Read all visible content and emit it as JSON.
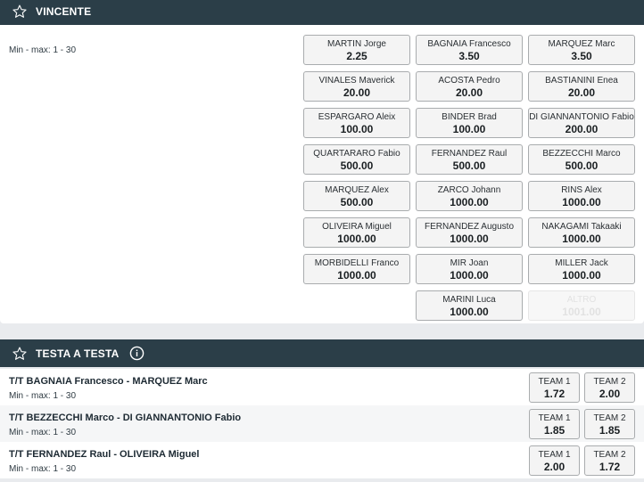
{
  "vincente": {
    "title": "VINCENTE",
    "minmax": "Min - max: 1 - 30",
    "odds": [
      {
        "label": "MARTIN Jorge",
        "value": "2.25"
      },
      {
        "label": "BAGNAIA Francesco",
        "value": "3.50"
      },
      {
        "label": "MARQUEZ Marc",
        "value": "3.50"
      },
      {
        "label": "VINALES Maverick",
        "value": "20.00"
      },
      {
        "label": "ACOSTA Pedro",
        "value": "20.00"
      },
      {
        "label": "BASTIANINI Enea",
        "value": "20.00"
      },
      {
        "label": "ESPARGARO Aleix",
        "value": "100.00"
      },
      {
        "label": "BINDER Brad",
        "value": "100.00"
      },
      {
        "label": "DI GIANNANTONIO Fabio",
        "value": "200.00"
      },
      {
        "label": "QUARTARARO Fabio",
        "value": "500.00"
      },
      {
        "label": "FERNANDEZ Raul",
        "value": "500.00"
      },
      {
        "label": "BEZZECCHI Marco",
        "value": "500.00"
      },
      {
        "label": "MARQUEZ Alex",
        "value": "500.00"
      },
      {
        "label": "ZARCO Johann",
        "value": "1000.00"
      },
      {
        "label": "RINS Alex",
        "value": "1000.00"
      },
      {
        "label": "OLIVEIRA Miguel",
        "value": "1000.00"
      },
      {
        "label": "FERNANDEZ Augusto",
        "value": "1000.00"
      },
      {
        "label": "NAKAGAMI Takaaki",
        "value": "1000.00"
      },
      {
        "label": "MORBIDELLI Franco",
        "value": "1000.00"
      },
      {
        "label": "MIR Joan",
        "value": "1000.00"
      },
      {
        "label": "MILLER Jack",
        "value": "1000.00"
      },
      {
        "label": "MARINI Luca",
        "value": "1000.00"
      },
      {
        "label": "ALTRO",
        "value": "1001.00"
      }
    ]
  },
  "testa": {
    "title": "TESTA A TESTA",
    "matches": [
      {
        "title": "T/T BAGNAIA Francesco - MARQUEZ Marc",
        "minmax": "Min - max: 1 - 30",
        "team1_label": "TEAM 1",
        "team1_value": "1.72",
        "team2_label": "TEAM 2",
        "team2_value": "2.00"
      },
      {
        "title": "T/T BEZZECCHI Marco - DI GIANNANTONIO Fabio",
        "minmax": "Min - max: 1 - 30",
        "team1_label": "TEAM 1",
        "team1_value": "1.85",
        "team2_label": "TEAM 2",
        "team2_value": "1.85"
      },
      {
        "title": "T/T FERNANDEZ Raul - OLIVEIRA Miguel",
        "minmax": "Min - max: 1 - 30",
        "team1_label": "TEAM 1",
        "team1_value": "2.00",
        "team2_label": "TEAM 2",
        "team2_value": "1.72"
      }
    ]
  },
  "icons": {
    "favorite": "star-outline-icon",
    "info": "info-circle-icon"
  },
  "colors": {
    "header_bg": "#2b3e48",
    "button_bg": "#f4f4f4",
    "button_border": "#a9acae"
  }
}
